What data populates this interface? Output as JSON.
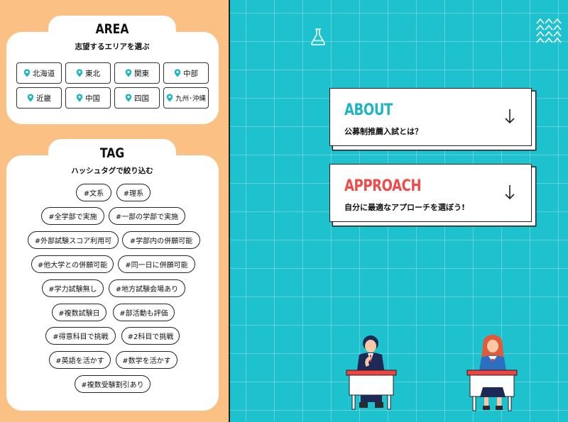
{
  "area": {
    "title": "AREA",
    "subtitle": "志望するエリアを選ぶ",
    "regions": [
      "北海道",
      "東北",
      "関東",
      "中部",
      "近畿",
      "中国",
      "四国",
      "九州･沖縄"
    ]
  },
  "tag": {
    "title": "TAG",
    "subtitle": "ハッシュタグで絞り込む",
    "tags": [
      "#文系",
      "#理系",
      "#全学部で実施",
      "#一部の学部で実施",
      "#外部試験スコア利用可",
      "#学部内の併願可能",
      "#他大学との併願可能",
      "#同一日に併願可能",
      "#学力試験無し",
      "#地方試験会場あり",
      "#複数試験日",
      "#部活動も評価",
      "#得意科目で挑戦",
      "#2科目で挑戦",
      "#英語を活かす",
      "#数学を活かす",
      "#複数受験割引あり"
    ]
  },
  "about": {
    "title": "ABOUT",
    "subtitle": "公募制推薦入試とは？",
    "color": "#1fb5c4"
  },
  "approach": {
    "title": "APPROACH",
    "subtitle": "自分に最適なアプローチを選ぼう!",
    "color": "#ef4b4b"
  },
  "colors": {
    "left_bg": "#fbc083",
    "right_bg": "#1ec1ce",
    "pin": "#1fb5c4"
  }
}
